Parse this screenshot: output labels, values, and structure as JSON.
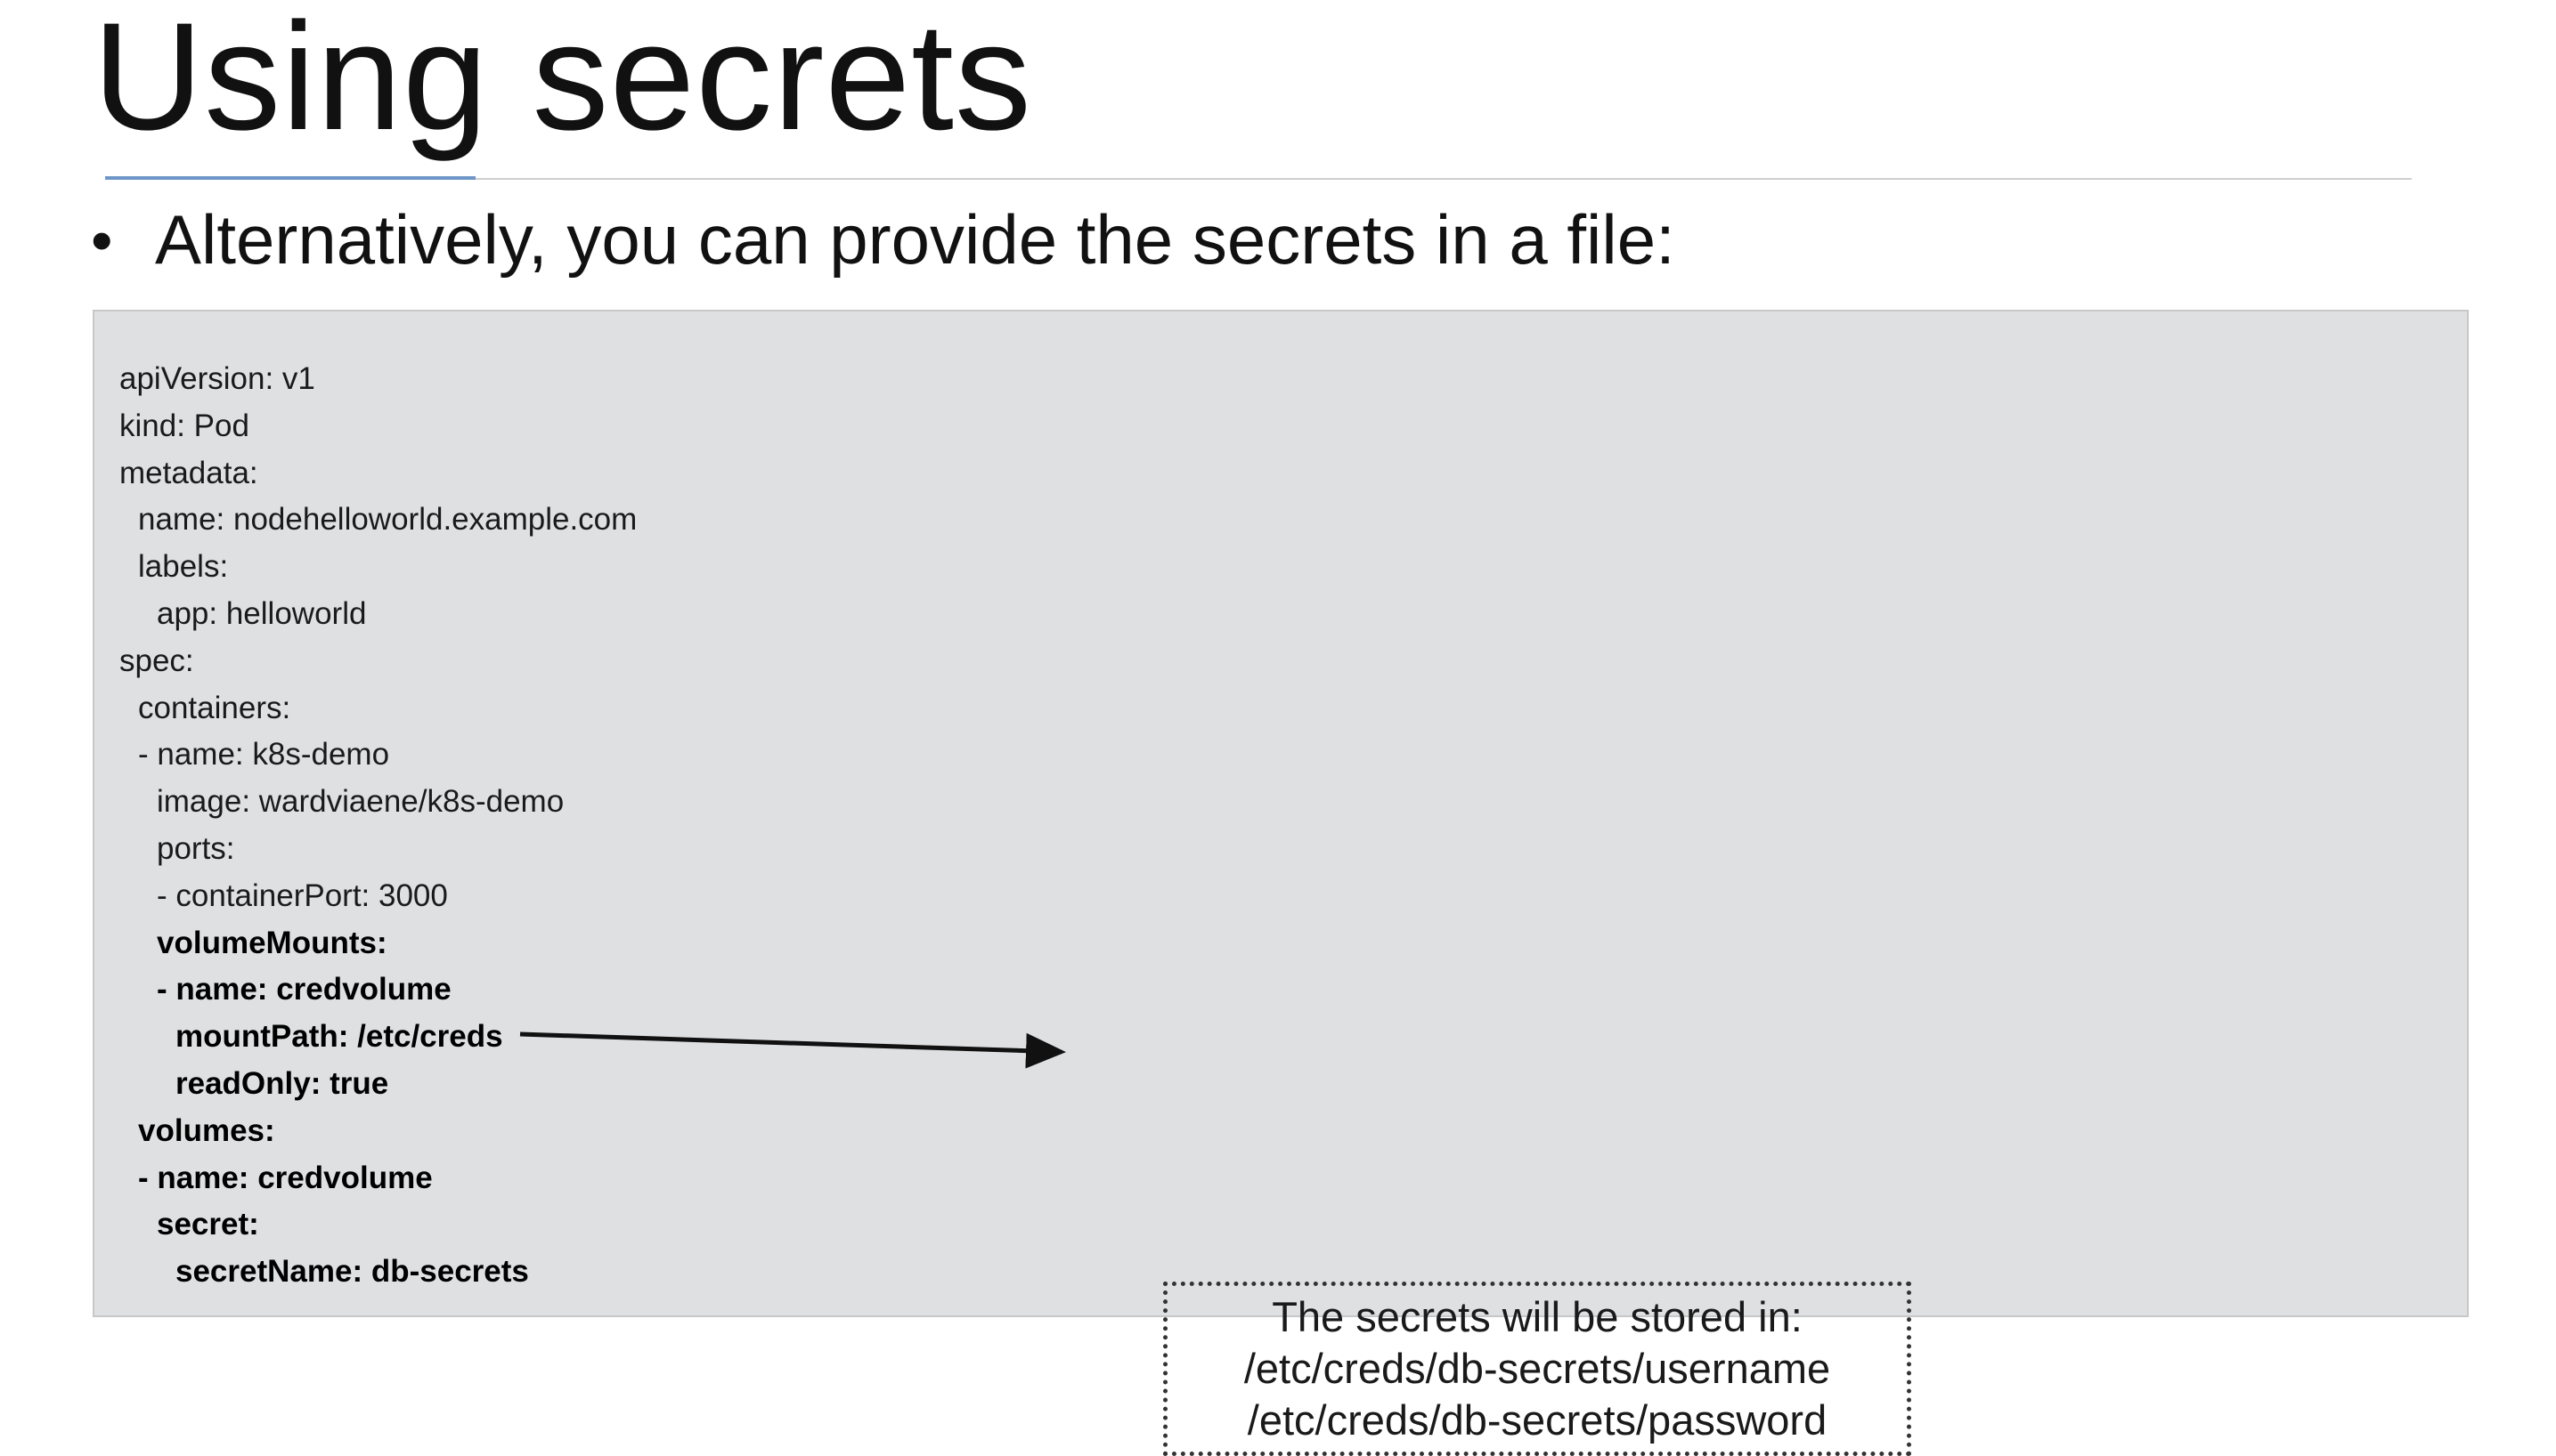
{
  "slide": {
    "title": "Using secrets",
    "bullet": "Alternatively, you can provide the secrets in a file:"
  },
  "code": {
    "lines": [
      {
        "text": "apiVersion: v1",
        "indent": 0,
        "bold": false
      },
      {
        "text": "kind: Pod",
        "indent": 0,
        "bold": false
      },
      {
        "text": "metadata:",
        "indent": 0,
        "bold": false
      },
      {
        "text": "name: nodehelloworld.example.com",
        "indent": 1,
        "bold": false
      },
      {
        "text": "labels:",
        "indent": 1,
        "bold": false
      },
      {
        "text": "app: helloworld",
        "indent": 2,
        "bold": false
      },
      {
        "text": "spec:",
        "indent": 0,
        "bold": false
      },
      {
        "text": "containers:",
        "indent": 1,
        "bold": false
      },
      {
        "text": "- name: k8s-demo",
        "indent": 1,
        "bold": false
      },
      {
        "text": "image: wardviaene/k8s-demo",
        "indent": 2,
        "bold": false
      },
      {
        "text": "ports:",
        "indent": 2,
        "bold": false
      },
      {
        "text": "- containerPort: 3000",
        "indent": 2,
        "bold": false
      },
      {
        "text": "volumeMounts:",
        "indent": 2,
        "bold": true
      },
      {
        "text": "- name: credvolume",
        "indent": 2,
        "bold": true
      },
      {
        "text": "mountPath: /etc/creds",
        "indent": 3,
        "bold": true
      },
      {
        "text": "readOnly: true",
        "indent": 3,
        "bold": true
      },
      {
        "text": "volumes:",
        "indent": 1,
        "bold": true
      },
      {
        "text": "- name: credvolume",
        "indent": 1,
        "bold": true
      },
      {
        "text": "secret:",
        "indent": 2,
        "bold": true
      },
      {
        "text": "secretName: db-secrets",
        "indent": 3,
        "bold": true
      }
    ]
  },
  "callout": {
    "line1": "The secrets will be stored in:",
    "line2": "/etc/creds/db-secrets/username",
    "line3": "/etc/creds/db-secrets/password"
  }
}
